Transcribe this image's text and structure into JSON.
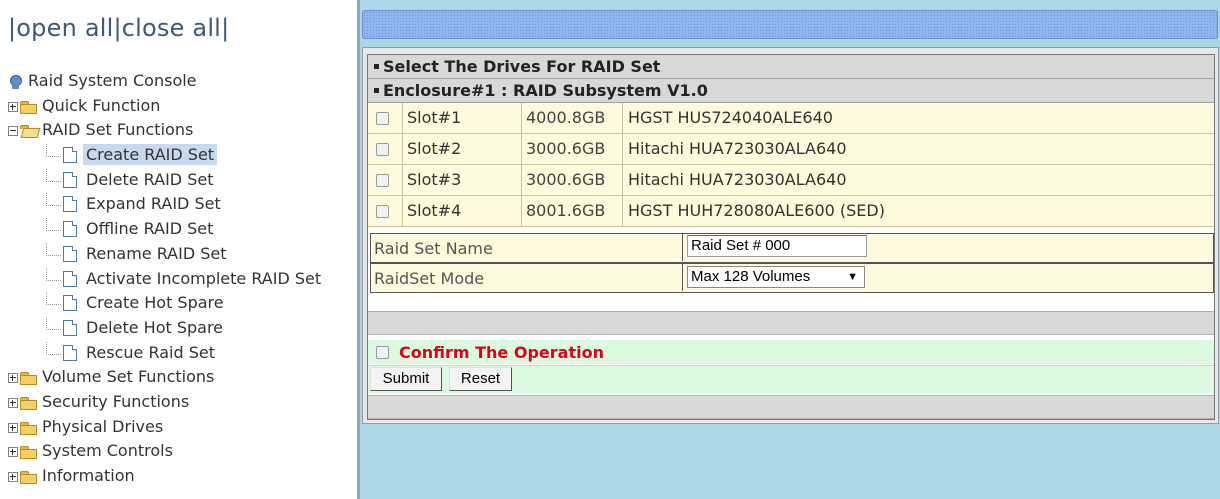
{
  "tree": {
    "open_all": "open all",
    "close_all": "close all",
    "root_label": "Raid System Console",
    "items": [
      {
        "label": "Quick Function",
        "expanded": false
      },
      {
        "label": "RAID Set Functions",
        "expanded": true,
        "children": [
          {
            "label": "Create RAID Set",
            "selected": true
          },
          {
            "label": "Delete RAID Set"
          },
          {
            "label": "Expand RAID Set"
          },
          {
            "label": "Offline RAID Set"
          },
          {
            "label": "Rename RAID Set"
          },
          {
            "label": "Activate Incomplete RAID Set"
          },
          {
            "label": "Create Hot Spare"
          },
          {
            "label": "Delete Hot Spare"
          },
          {
            "label": "Rescue Raid Set"
          }
        ]
      },
      {
        "label": "Volume Set Functions",
        "expanded": false
      },
      {
        "label": "Security Functions",
        "expanded": false
      },
      {
        "label": "Physical Drives",
        "expanded": false
      },
      {
        "label": "System Controls",
        "expanded": false
      },
      {
        "label": "Information",
        "expanded": false
      }
    ]
  },
  "main": {
    "select_header": "Select The Drives For RAID Set",
    "enclosure_header": "Enclosure#1 : RAID Subsystem V1.0",
    "drives": [
      {
        "slot": "Slot#1",
        "capacity": "4000.8GB",
        "model": "HGST HUS724040ALE640"
      },
      {
        "slot": "Slot#2",
        "capacity": "3000.6GB",
        "model": "Hitachi HUA723030ALA640"
      },
      {
        "slot": "Slot#3",
        "capacity": "3000.6GB",
        "model": "Hitachi HUA723030ALA640"
      },
      {
        "slot": "Slot#4",
        "capacity": "8001.6GB",
        "model": "HGST HUH728080ALE600 (SED)"
      }
    ],
    "name_label": "Raid Set Name",
    "name_value": "Raid Set # 000",
    "mode_label": "RaidSet Mode",
    "mode_value": "Max 128 Volumes",
    "confirm_label": "Confirm The Operation",
    "submit_label": "Submit",
    "reset_label": "Reset"
  },
  "colors": {
    "accent_red": "#e0001a",
    "row_yellow": "#fff9dd",
    "row_green": "#dbfadf",
    "pane_blue": "#abd6e4"
  }
}
